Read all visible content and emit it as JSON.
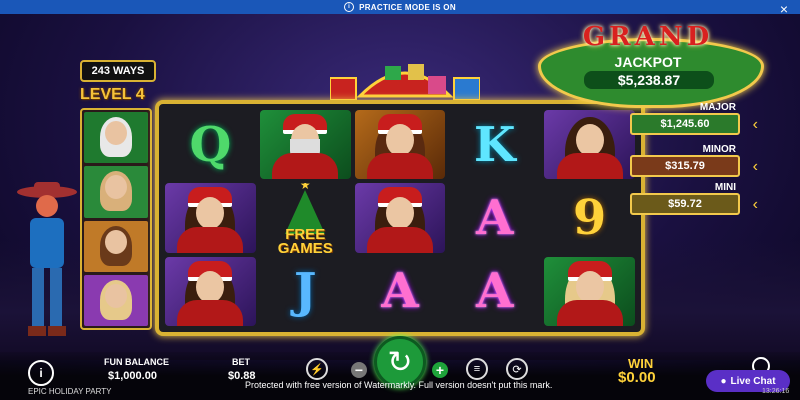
{
  "topbar": {
    "text": "PRACTICE MODE IS ON",
    "close_icon": "×"
  },
  "ways": "243 WAYS",
  "level": "LEVEL 4",
  "jackpots": {
    "grand_title": "GRAND",
    "grand_sub": "JACKPOT",
    "grand_value": "$5,238.87",
    "major_label": "MAJOR",
    "major_value": "$1,245.60",
    "minor_label": "MINOR",
    "minor_value": "$315.79",
    "mini_label": "MINI",
    "mini_value": "$59.72"
  },
  "reels": [
    [
      "Q",
      "santa",
      "woman-red",
      "K",
      "woman-purple"
    ],
    [
      "woman-purple",
      "free-games",
      "woman-purple",
      "A",
      "9"
    ],
    [
      "woman-purple",
      "J",
      "A",
      "A",
      "woman-green"
    ]
  ],
  "free_games_text": "FREE\nGAMES",
  "bottom": {
    "fun_balance_label": "FUN BALANCE",
    "fun_balance_value": "$1,000.00",
    "bet_label": "BET",
    "bet_value": "$0.88",
    "win_label": "WIN",
    "win_value": "$0.00",
    "game_name": "EPIC HOLIDAY PARTY",
    "watermark": "Protected with free version of Watermarkly. Full version doesn't put this mark.",
    "live_chat": "Live Chat",
    "clock": "13:26:16"
  },
  "colors": {
    "accent_gold": "#d9b233",
    "spin_green": "#1d9a3a",
    "topbar_blue": "#1a57b8"
  }
}
